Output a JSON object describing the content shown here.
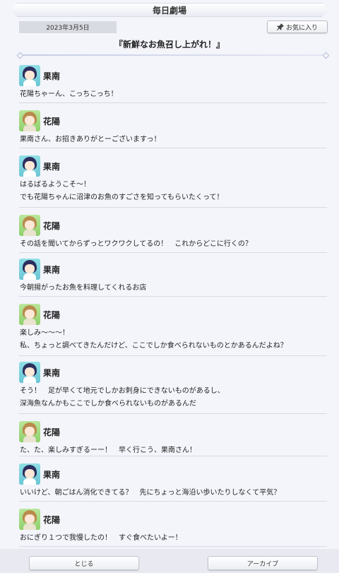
{
  "header": {
    "title": "毎日劇場"
  },
  "date": "2023年3月5日",
  "favorite_button": {
    "label": "お気に入り",
    "icon": "pin-icon"
  },
  "episode_title": "『新鮮なお魚召し上がれ！』",
  "dialogue": [
    {
      "speaker": "果南",
      "avatar": "kanan",
      "lines": [
        "花陽ちゃーん、こっちこっち！"
      ]
    },
    {
      "speaker": "花陽",
      "avatar": "hanayo",
      "lines": [
        "果南さん、お招きありがとーございますっ！"
      ]
    },
    {
      "speaker": "果南",
      "avatar": "kanan",
      "lines": [
        "はるばるようこそ～！",
        "でも花陽ちゃんに沼津のお魚のすごさを知ってもらいたくって！"
      ]
    },
    {
      "speaker": "花陽",
      "avatar": "hanayo",
      "lines": [
        "その話を聞いてからずっとワクワクしてるの！　これからどこに行くの？"
      ]
    },
    {
      "speaker": "果南",
      "avatar": "kanan",
      "lines": [
        "今朝揚がったお魚を料理してくれるお店"
      ]
    },
    {
      "speaker": "花陽",
      "avatar": "hanayo",
      "lines": [
        "楽しみ～～～！",
        "私、ちょっと調べてきたんだけど、ここでしか食べられないものとかあるんだよね？"
      ]
    },
    {
      "speaker": "果南",
      "avatar": "kanan",
      "lines": [
        "そう！　足が早くて地元でしかお刺身にできないものがあるし、",
        "深海魚なんかもここでしか食べられないものがあるんだ"
      ]
    },
    {
      "speaker": "花陽",
      "avatar": "hanayo",
      "lines": [
        "た、た、楽しみすぎるーー！　早く行こう、果南さん！"
      ]
    },
    {
      "speaker": "果南",
      "avatar": "kanan",
      "lines": [
        "いいけど、朝ごはん消化できてる？　先にちょっと海沿い歩いたりしなくて平気？"
      ]
    },
    {
      "speaker": "花陽",
      "avatar": "hanayo",
      "lines": [
        "おにぎり１つで我慢したの！　すぐ食べたいよー！"
      ]
    }
  ],
  "footer": {
    "close_label": "とじる",
    "archive_label": "アーカイブ"
  }
}
